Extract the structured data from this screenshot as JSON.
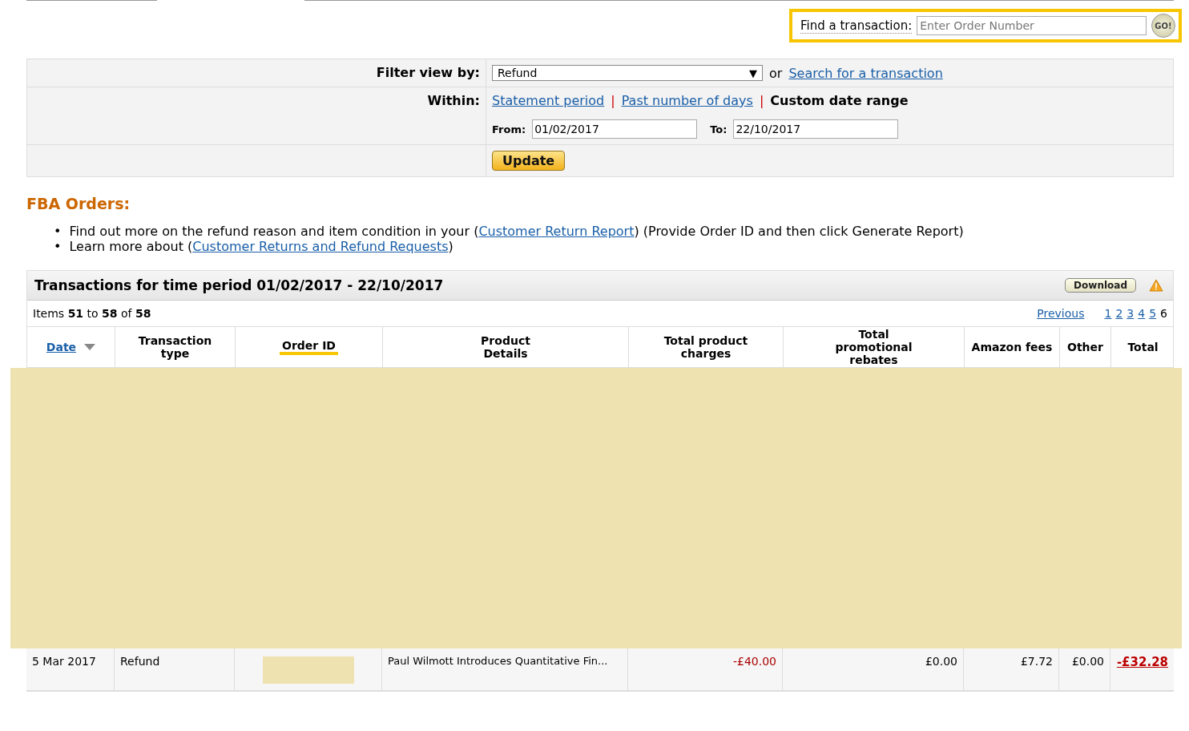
{
  "find_transaction": {
    "label": "Find a transaction:",
    "placeholder": "Enter Order Number",
    "button": "GO!"
  },
  "filter": {
    "label": "Filter view by:",
    "value": "Refund",
    "or_text": "or",
    "search_link": "Search for a transaction",
    "caret": "▼",
    "separators": [
      "|",
      "|"
    ],
    "within_label": "Within:",
    "within_options": [
      {
        "label": "Statement period",
        "selected": false
      },
      {
        "label": "Past number of days",
        "selected": false
      },
      {
        "label": "Custom date range",
        "selected": true
      }
    ],
    "from_label": "From:",
    "from_value": "01/02/2017",
    "to_label": "To:",
    "to_value": "22/10/2017",
    "update_button": "Update"
  },
  "section_title": "FBA Orders:",
  "bullets": [
    {
      "marker": "•",
      "before": "Find out more on the refund reason and item condition in your (",
      "link": "Customer Return Report",
      "after": ") (Provide Order ID and then click Generate Report)"
    },
    {
      "marker": "•",
      "before": "Learn more about (",
      "link": "Customer Returns and Refund Requests",
      "after": ")"
    }
  ],
  "transactions": {
    "title": "Transactions for time period 01/02/2017 - 22/10/2017",
    "download": "Download",
    "items_text": "Items **51** to **58** of **58**",
    "previous": "Previous",
    "pages": [
      {
        "label": "1",
        "selected": false
      },
      {
        "label": "2",
        "selected": false
      },
      {
        "label": "3",
        "selected": false
      },
      {
        "label": "4",
        "selected": false
      },
      {
        "label": "5",
        "selected": false
      },
      {
        "label": "6",
        "selected": true
      }
    ],
    "columns": [
      {
        "label": "Date",
        "sortable": true
      },
      {
        "label": "Transaction type",
        "sortable": false
      },
      {
        "label": "Order ID",
        "sortable": false
      },
      {
        "label": "Product Details",
        "sortable": false
      },
      {
        "label": "Total product charges",
        "sortable": false
      },
      {
        "label": "Total promotional rebates",
        "sortable": false
      },
      {
        "label": "Amazon fees",
        "sortable": false
      },
      {
        "label": "Other",
        "sortable": false
      },
      {
        "label": "Total",
        "sortable": false
      }
    ],
    "rows": [
      {
        "date": "5 Mar 2017",
        "type": "Refund",
        "product": "Paul Wilmott Introduces Quantitative Fin...",
        "charges": "-£40.00",
        "rebates": "£0.00",
        "fees": "£7.72",
        "other": "£0.00",
        "total": "-£32.28"
      }
    ]
  }
}
